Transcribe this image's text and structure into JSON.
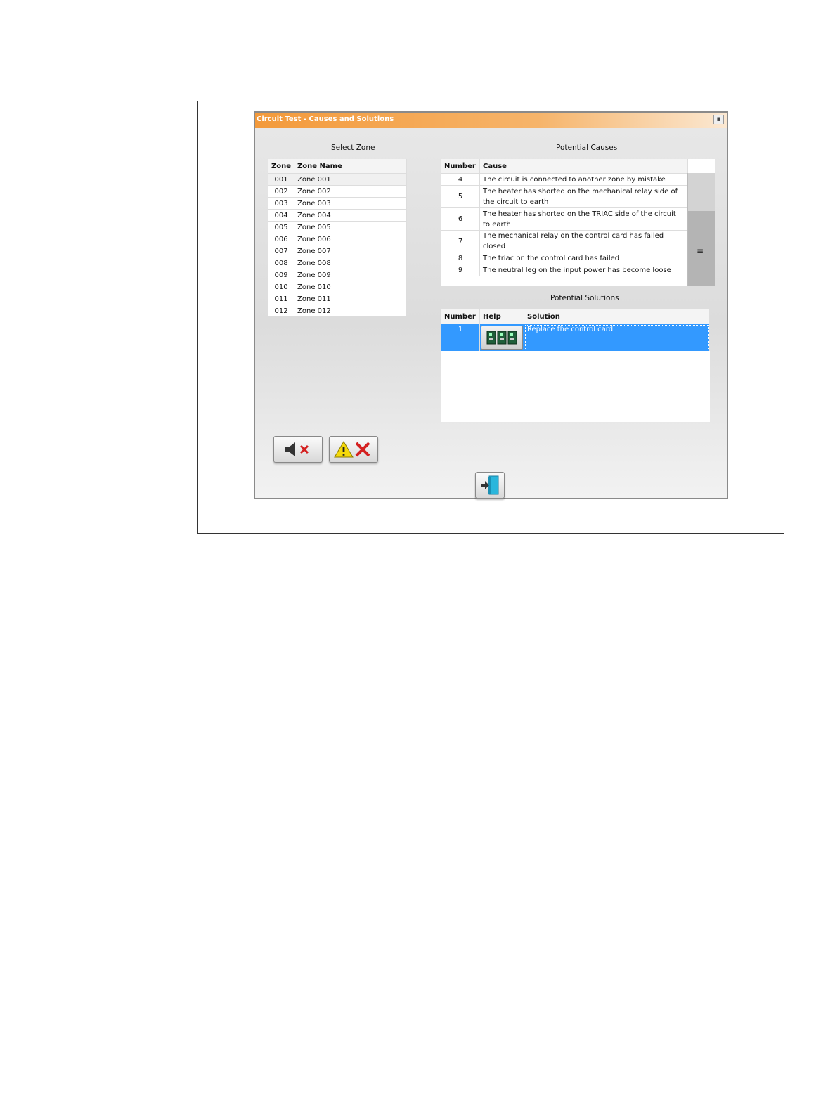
{
  "window": {
    "title": "Circuit Test - Causes and Solutions"
  },
  "zones": {
    "caption": "Select Zone",
    "headers": [
      "Zone",
      "Zone Name"
    ],
    "rows": [
      [
        "001",
        "Zone 001"
      ],
      [
        "002",
        "Zone 002"
      ],
      [
        "003",
        "Zone 003"
      ],
      [
        "004",
        "Zone 004"
      ],
      [
        "005",
        "Zone 005"
      ],
      [
        "006",
        "Zone 006"
      ],
      [
        "007",
        "Zone 007"
      ],
      [
        "008",
        "Zone 008"
      ],
      [
        "009",
        "Zone 009"
      ],
      [
        "010",
        "Zone 010"
      ],
      [
        "011",
        "Zone 011"
      ],
      [
        "012",
        "Zone 012"
      ]
    ]
  },
  "causes": {
    "caption": "Potential Causes",
    "headers": [
      "Number",
      "Cause"
    ],
    "rows": [
      [
        "4",
        "The circuit is connected to another zone by mistake"
      ],
      [
        "5",
        "The heater has shorted on the mechanical relay side of the circuit to earth"
      ],
      [
        "6",
        "The heater has shorted on the TRIAC side of the circuit to earth"
      ],
      [
        "7",
        "The mechanical relay on the control card has failed closed"
      ],
      [
        "8",
        "The triac on the control card has failed"
      ],
      [
        "9",
        "The neutral leg on the input power has become loose"
      ]
    ]
  },
  "solutions": {
    "caption": "Potential Solutions",
    "headers": [
      "Number",
      "Help",
      "Solution"
    ],
    "rows": [
      [
        "1",
        "Replace the control card"
      ]
    ]
  },
  "icons": {
    "mute": "speaker-muted-icon",
    "clear_alarm": "warning-clear-icon",
    "exit": "exit-door-icon",
    "help": "control-card-icon",
    "menu": "hamburger-icon"
  },
  "colors": {
    "title_orange": "#f39a3b",
    "selection_blue": "#3399ff"
  }
}
